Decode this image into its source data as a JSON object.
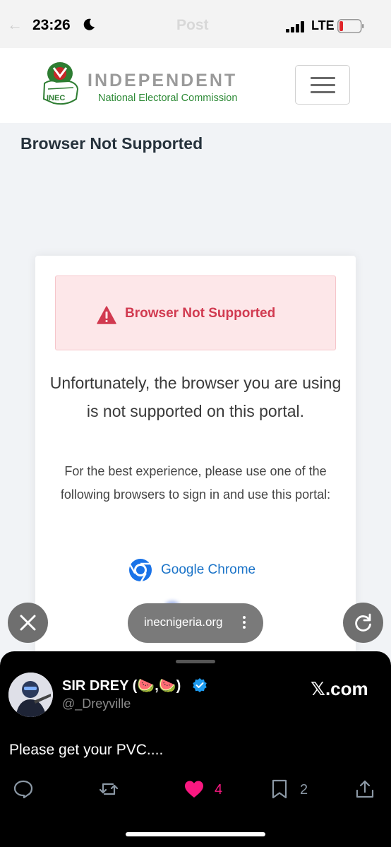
{
  "status_bar": {
    "time": "23:26",
    "ghost_title": "Post",
    "network": "LTE",
    "dnd": "moon-icon",
    "battery_level": 0.12
  },
  "header": {
    "brand_title": "INDEPENDENT",
    "brand_subtitle": "National Electoral Commission",
    "logo_text": "INEC",
    "menu_icon": "hamburger-icon"
  },
  "page": {
    "title": "Browser Not Supported"
  },
  "card": {
    "alert_title": "Browser Not Supported",
    "alert_icon": "warning-triangle-icon",
    "lead": "Unfortunately, the browser you are using is not supported on this portal.",
    "sub": "For the best experience, please use one of the following browsers to sign in and use this portal:",
    "browsers": [
      {
        "name": "Google Chrome",
        "icon": "chrome-icon"
      }
    ]
  },
  "browser_controls": {
    "close_icon": "close-icon",
    "url": "inecnigeria.org",
    "more_icon": "more-vertical-icon",
    "reload_icon": "reload-icon"
  },
  "post": {
    "author_name": "SIR DREY (🍉,🍉)",
    "author_handle": "@_Dreyville",
    "source": "𝕏.com",
    "text": "Please get your PVC....",
    "actions": {
      "reply_count": "",
      "repost_count": "",
      "like_count": "4",
      "bookmark_count": "2"
    },
    "colors": {
      "like": "#f91880",
      "icon": "#8b98a5",
      "verified": "#1d9bf0"
    }
  }
}
